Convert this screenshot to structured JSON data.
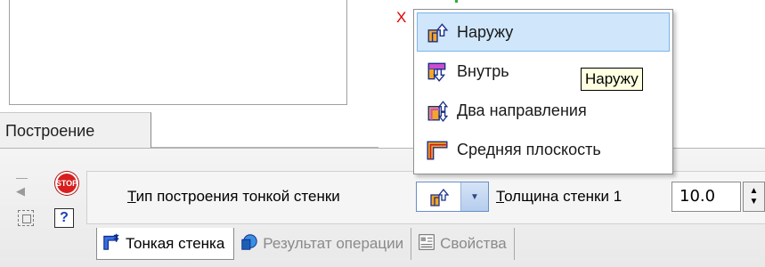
{
  "panel": {
    "tab_label": "Построение"
  },
  "canvas": {
    "axis_label": "X"
  },
  "dropdown": {
    "items": [
      {
        "label": "Наружу",
        "icon": "wall-outward-icon",
        "highlighted": true
      },
      {
        "label": "Внутрь",
        "icon": "wall-inward-icon",
        "highlighted": false
      },
      {
        "label": "Два направления",
        "icon": "wall-both-directions-icon",
        "highlighted": false
      },
      {
        "label": "Средняя плоскость",
        "icon": "wall-midplane-icon",
        "highlighted": false
      }
    ],
    "tooltip": "Наружу"
  },
  "properties": {
    "type_label_first_letter": "Т",
    "type_label_rest": "ип построения тонкой стенки",
    "thickness_label_first_letter": "Т",
    "thickness_label_rest": "олщина стенки 1",
    "thickness_value": "10.0",
    "stop_icon_text": "STOP",
    "help_icon_text": "?"
  },
  "tabs": [
    {
      "label": "Тонкая стенка",
      "icon": "thin-wall-icon",
      "active": true
    },
    {
      "label": "Результат операции",
      "icon": "operation-result-icon",
      "active": false
    },
    {
      "label": "Свойства",
      "icon": "properties-icon",
      "active": false
    }
  ],
  "colors": {
    "accent_orange": "#f5a623",
    "accent_blue": "#2a58c9",
    "highlight": "#cfe6fb",
    "stop_red": "#d81e1e"
  }
}
